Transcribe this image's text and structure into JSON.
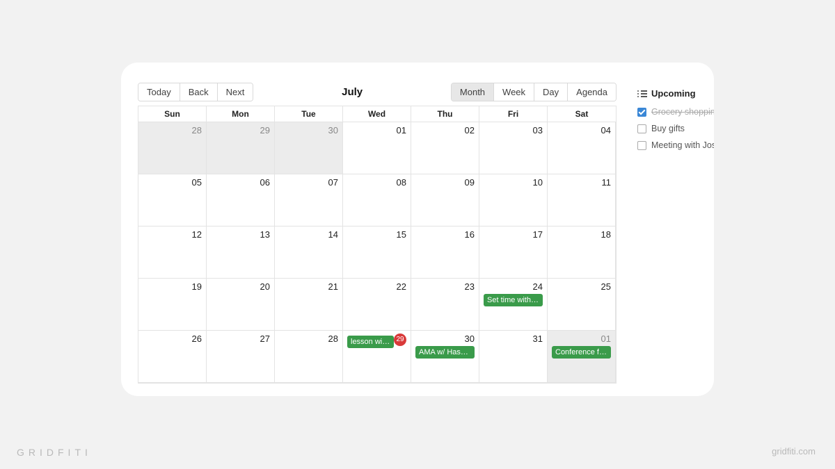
{
  "toolbar": {
    "today": "Today",
    "back": "Back",
    "next": "Next",
    "title": "July",
    "month": "Month",
    "week": "Week",
    "day": "Day",
    "agenda": "Agenda"
  },
  "weekdays": [
    "Sun",
    "Mon",
    "Tue",
    "Wed",
    "Thu",
    "Fri",
    "Sat"
  ],
  "cells": {
    "r0c0": "28",
    "r0c1": "29",
    "r0c2": "30",
    "r0c3": "01",
    "r0c4": "02",
    "r0c5": "03",
    "r0c6": "04",
    "r1c0": "05",
    "r1c1": "06",
    "r1c2": "07",
    "r1c3": "08",
    "r1c4": "09",
    "r1c5": "10",
    "r1c6": "11",
    "r2c0": "12",
    "r2c1": "13",
    "r2c2": "14",
    "r2c3": "15",
    "r2c4": "16",
    "r2c5": "17",
    "r2c6": "18",
    "r3c0": "19",
    "r3c1": "20",
    "r3c2": "21",
    "r3c3": "22",
    "r3c4": "23",
    "r3c5": "24",
    "r3c6": "25",
    "r4c0": "26",
    "r4c1": "27",
    "r4c2": "28",
    "r4c3": "29",
    "r4c4": "30",
    "r4c5": "31",
    "r4c6": "01"
  },
  "events": {
    "fri24": "Set time with Li...",
    "wed29": "lesson with Prof...",
    "thu30": "AMA w/ Hasque...",
    "sat01": "Conference for ..."
  },
  "sidebar": {
    "title": "Upcoming",
    "tasks": [
      {
        "label": "Grocery shoppin",
        "done": true
      },
      {
        "label": "Buy gifts",
        "done": false
      },
      {
        "label": "Meeting with Jos",
        "done": false
      }
    ]
  },
  "brand": {
    "left": "GRIDFITI",
    "right": "gridfiti.com"
  },
  "colors": {
    "event": "#3a9b4a",
    "todayBadge": "#d93a3a",
    "check": "#3a87d6"
  }
}
